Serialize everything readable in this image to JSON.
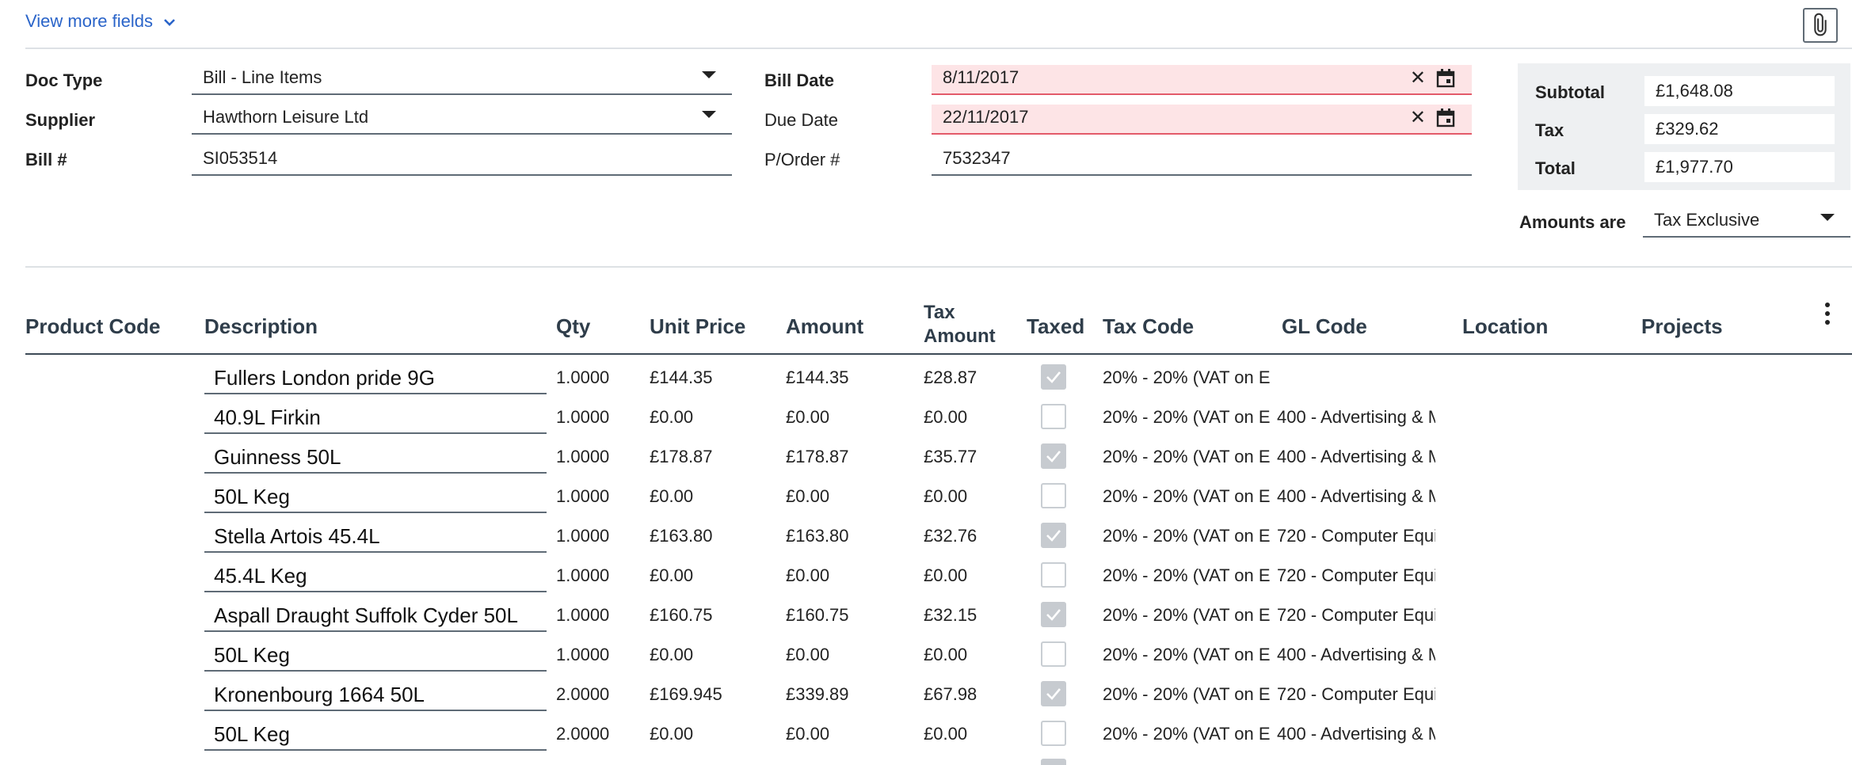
{
  "header": {
    "view_more_fields": "View more fields"
  },
  "form": {
    "doc_type": {
      "label": "Doc Type",
      "value": "Bill - Line Items"
    },
    "supplier": {
      "label": "Supplier",
      "value": "Hawthorn Leisure Ltd"
    },
    "bill_number": {
      "label": "Bill #",
      "value": "SI053514"
    },
    "bill_date": {
      "label": "Bill Date",
      "value": "8/11/2017"
    },
    "due_date": {
      "label": "Due Date",
      "value": "22/11/2017"
    },
    "purchase_order": {
      "label": "P/Order #",
      "value": "7532347"
    }
  },
  "totals": {
    "subtotal_label": "Subtotal",
    "subtotal_value": "£1,648.08",
    "tax_label": "Tax",
    "tax_value": "£329.62",
    "total_label": "Total",
    "total_value": "£1,977.70"
  },
  "amounts": {
    "label": "Amounts are",
    "value": "Tax Exclusive"
  },
  "table": {
    "headers": {
      "product_code": "Product Code",
      "description": "Description",
      "qty": "Qty",
      "unit_price": "Unit Price",
      "amount": "Amount",
      "tax_amount_1": "Tax",
      "tax_amount_2": "Amount",
      "taxed": "Taxed",
      "tax_code": "Tax Code",
      "gl_code": "GL Code",
      "location": "Location",
      "projects": "Projects"
    },
    "rows": [
      {
        "description": "Fullers London pride 9G",
        "qty": "1.0000",
        "unit_price": "£144.35",
        "amount": "£144.35",
        "tax_amount": "£28.87",
        "taxed": true,
        "tax_code": "20% - 20% (VAT on E",
        "gl_code": ""
      },
      {
        "description": "40.9L Firkin",
        "qty": "1.0000",
        "unit_price": "£0.00",
        "amount": "£0.00",
        "tax_amount": "£0.00",
        "taxed": false,
        "tax_code": "20% - 20% (VAT on E",
        "gl_code": "400 - Advertising & M"
      },
      {
        "description": "Guinness  50L",
        "qty": "1.0000",
        "unit_price": "£178.87",
        "amount": "£178.87",
        "tax_amount": "£35.77",
        "taxed": true,
        "tax_code": "20% - 20% (VAT on E",
        "gl_code": "400 - Advertising & M"
      },
      {
        "description": "50L Keg",
        "qty": "1.0000",
        "unit_price": "£0.00",
        "amount": "£0.00",
        "tax_amount": "£0.00",
        "taxed": false,
        "tax_code": "20% - 20% (VAT on E",
        "gl_code": "400 - Advertising & M"
      },
      {
        "description": "Stella Artois  45.4L",
        "qty": "1.0000",
        "unit_price": "£163.80",
        "amount": "£163.80",
        "tax_amount": "£32.76",
        "taxed": true,
        "tax_code": "20% - 20% (VAT on E",
        "gl_code": "720 - Computer Equi"
      },
      {
        "description": "45.4L Keg",
        "qty": "1.0000",
        "unit_price": "£0.00",
        "amount": "£0.00",
        "tax_amount": "£0.00",
        "taxed": false,
        "tax_code": "20% - 20% (VAT on E",
        "gl_code": "720 - Computer Equi"
      },
      {
        "description": "Aspall Draught Suffolk Cyder 50L",
        "qty": "1.0000",
        "unit_price": "£160.75",
        "amount": "£160.75",
        "tax_amount": "£32.15",
        "taxed": true,
        "tax_code": "20% - 20% (VAT on E",
        "gl_code": "720 - Computer Equi"
      },
      {
        "description": "50L Keg",
        "qty": "1.0000",
        "unit_price": "£0.00",
        "amount": "£0.00",
        "tax_amount": "£0.00",
        "taxed": false,
        "tax_code": "20% - 20% (VAT on E",
        "gl_code": "400 - Advertising & M"
      },
      {
        "description": "Kronenbourg 1664  50L",
        "qty": "2.0000",
        "unit_price": "£169.945",
        "amount": "£339.89",
        "tax_amount": "£67.98",
        "taxed": true,
        "tax_code": "20% - 20% (VAT on E",
        "gl_code": "720 - Computer Equi"
      },
      {
        "description": "50L Keg",
        "qty": "2.0000",
        "unit_price": "£0.00",
        "amount": "£0.00",
        "tax_amount": "£0.00",
        "taxed": false,
        "tax_code": "20% - 20% (VAT on E",
        "gl_code": "400 - Advertising & M"
      }
    ]
  },
  "colors": {
    "link": "#2a64c9",
    "error_bg": "#fde4e6",
    "error_line": "#e35a6a",
    "panel_bg": "#eef0f2"
  }
}
